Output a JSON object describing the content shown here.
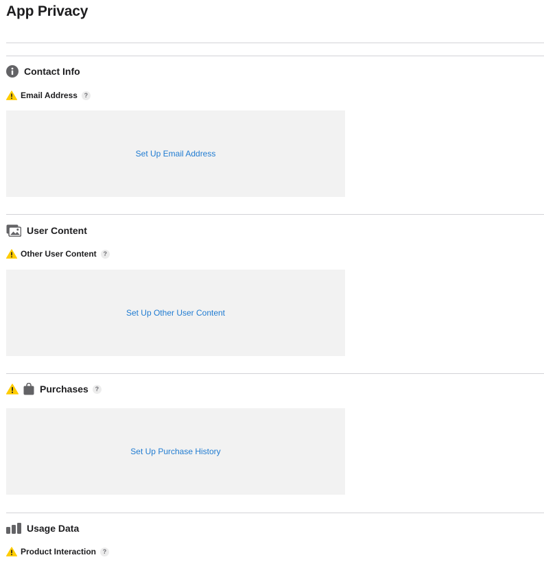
{
  "page": {
    "title": "App Privacy"
  },
  "sections": {
    "contact_info": {
      "label": "Contact Info",
      "icon": "info-circle-icon",
      "item_label": "Email Address",
      "help": "?",
      "action": "Set Up Email Address"
    },
    "user_content": {
      "label": "User Content",
      "icon": "photos-icon",
      "item_label": "Other User Content",
      "help": "?",
      "action": "Set Up Other User Content"
    },
    "purchases": {
      "label": "Purchases",
      "icon": "shopping-bag-icon",
      "help": "?",
      "action": "Set Up Purchase History"
    },
    "usage_data": {
      "label": "Usage Data",
      "icon": "bar-chart-icon",
      "item_label": "Product Interaction",
      "help": "?"
    }
  },
  "colors": {
    "link": "#1f7bd1",
    "warning": "#ffcc00",
    "icon": "#636366",
    "box": "#f2f2f2",
    "rule": "#d2d2d7"
  }
}
